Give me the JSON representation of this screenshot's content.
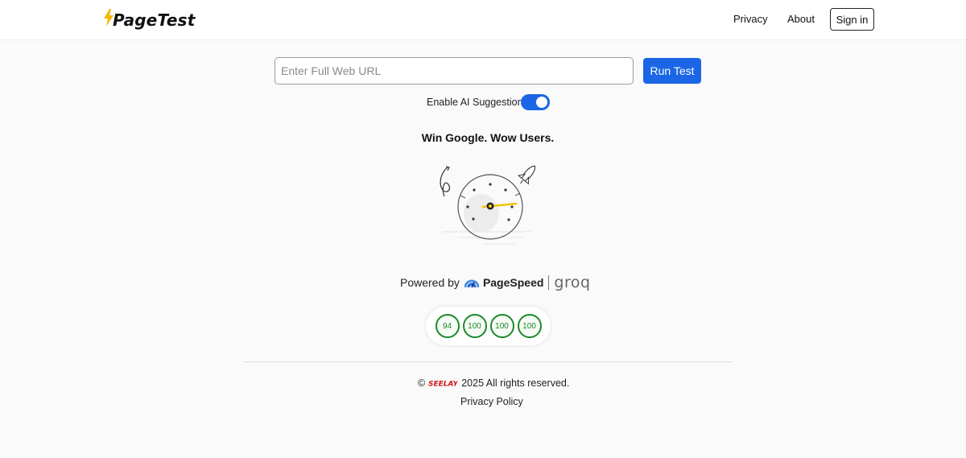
{
  "header": {
    "logo_text": "PageTest",
    "nav": {
      "privacy": "Privacy",
      "about": "About"
    },
    "sign_in": "Sign in"
  },
  "search": {
    "value": "",
    "placeholder": "Enter Full Web URL",
    "run_button": "Run Test"
  },
  "ai_toggle": {
    "label": "Enable AI Suggestions",
    "enabled": true
  },
  "tagline": "Win Google. Wow Users.",
  "illustration": {
    "icon": "speedometer-illustration",
    "gauge_needle_color": "#f5c400"
  },
  "powered_by": {
    "label": "Powered by",
    "pagespeed": "PageSpeed",
    "groq": "groq"
  },
  "scores": [
    "94",
    "100",
    "100",
    "100"
  ],
  "footer": {
    "copyright_symbol": "©",
    "brand_logo_text": "SEELAY",
    "rights": "2025 All rights reserved.",
    "privacy_policy": "Privacy Policy"
  },
  "colors": {
    "accent": "#1a66e6",
    "score_good": "#1a8a2a",
    "brand_red": "#d01818",
    "bolt": "#f5b800"
  }
}
